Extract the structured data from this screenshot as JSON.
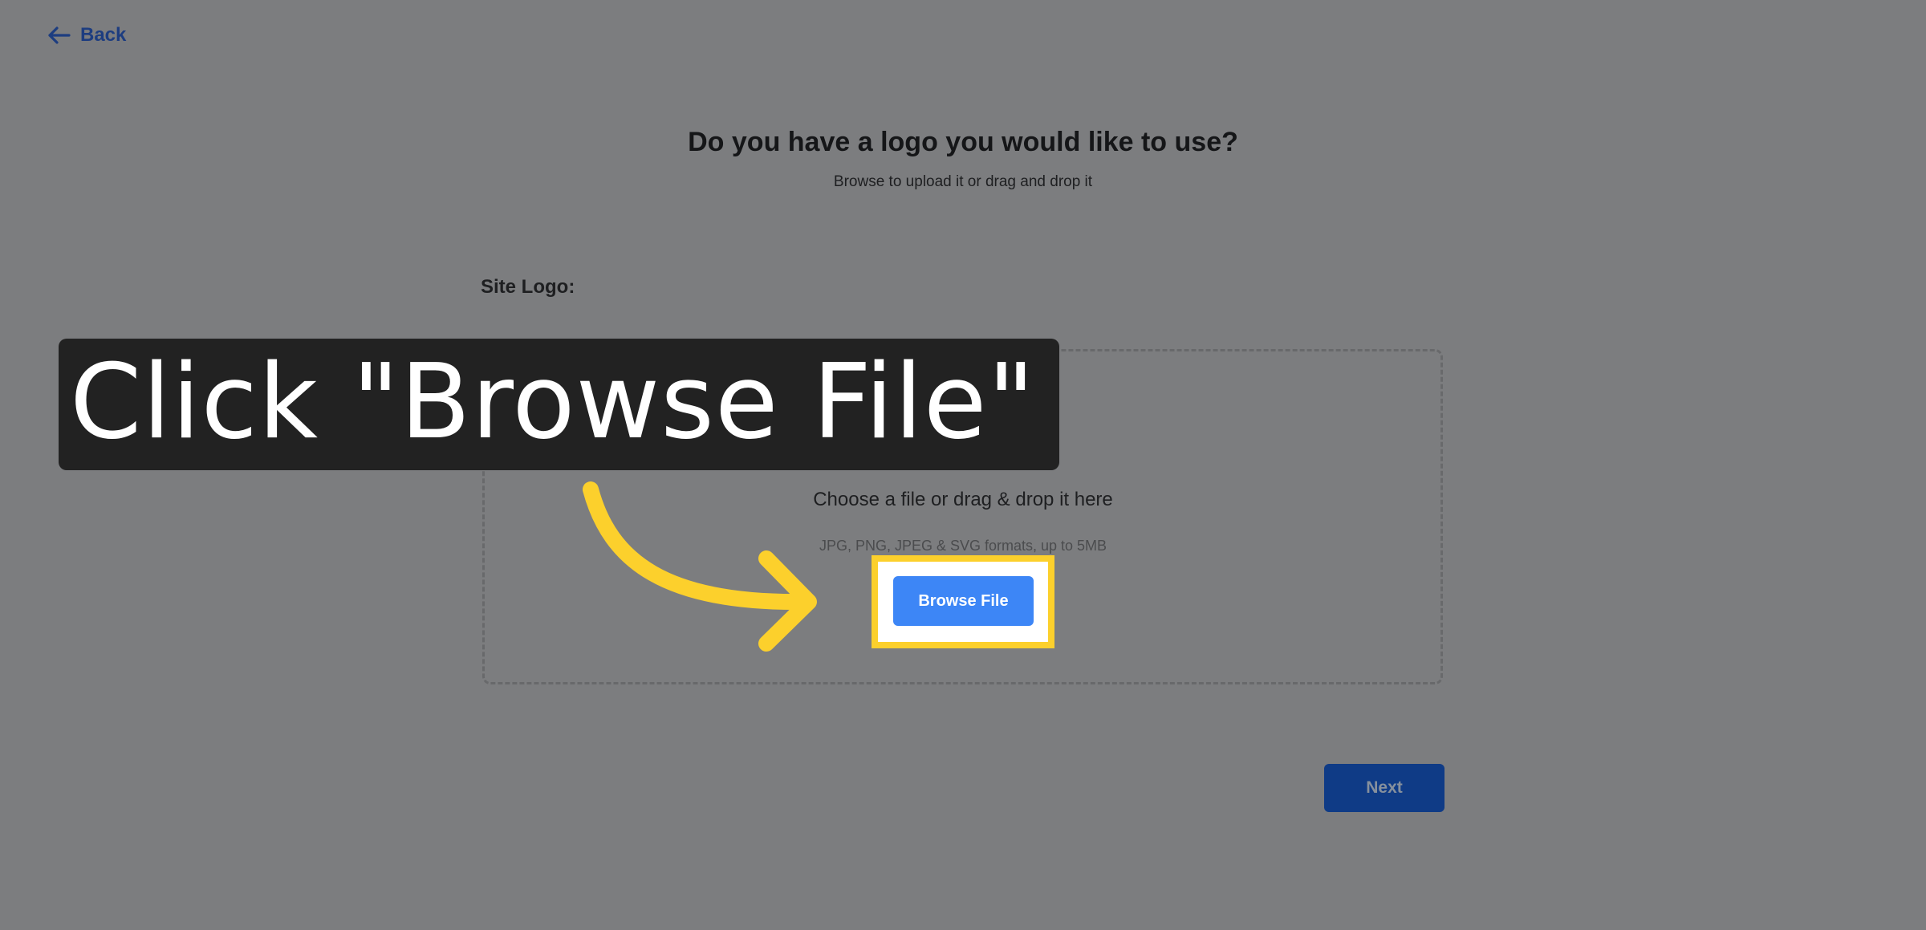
{
  "nav": {
    "back_label": "Back"
  },
  "header": {
    "title": "Do you have a logo you would like to use?",
    "subtitle": "Browse to upload it or drag and drop it"
  },
  "form": {
    "field_label": "Site Logo:",
    "dropzone": {
      "text": "Choose a file or drag & drop it here",
      "hint": "JPG, PNG, JPEG & SVG formats, up to 5MB",
      "browse_label": "Browse File"
    },
    "next_label": "Next"
  },
  "annotation": {
    "callout_text": "Click \"Browse File\""
  },
  "icons": {
    "back": "arrow-left-icon",
    "upload": "upload-icon",
    "pointer": "curved-arrow-icon"
  },
  "colors": {
    "backdrop": "#7c7d7f",
    "link": "#1d3d80",
    "primary_button": "#3d86f6",
    "next_button": "#0f3b86",
    "highlight": "#fcd02c",
    "callout_bg": "#222222"
  }
}
